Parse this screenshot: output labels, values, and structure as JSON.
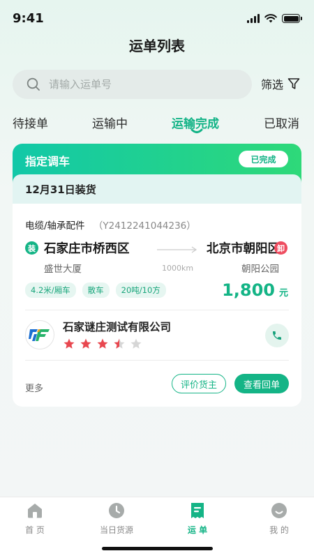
{
  "status_bar": {
    "time": "9:41"
  },
  "page": {
    "title": "运单列表"
  },
  "search": {
    "placeholder": "请输入运单号",
    "value": ""
  },
  "filter": {
    "label": "筛选",
    "icon": "filter-icon"
  },
  "tabs": [
    {
      "label": "待接单",
      "active": false
    },
    {
      "label": "运输中",
      "active": false
    },
    {
      "label": "运输完成",
      "active": true
    },
    {
      "label": "已取消",
      "active": false
    }
  ],
  "order": {
    "dispatch_type": "指定调车",
    "status": "已完成",
    "load_date": "12月31日装货",
    "cargo_name": "电缆/轴承配件",
    "order_id": "（Y2412241044236）",
    "origin": {
      "tag": "装",
      "city": "石家庄市桥西区",
      "place": "盛世大厦"
    },
    "destination": {
      "tag": "卸",
      "city": "北京市朝阳区",
      "place": "朝阳公园"
    },
    "distance": "1000km",
    "chips": [
      "4.2米/厢车",
      "散车",
      "20吨/10方"
    ],
    "price": "1,800",
    "price_unit": "元",
    "shipper": {
      "name": "石家谜庄测试有限公司",
      "rating": 3.5,
      "rating_max": 5
    },
    "more_label": "更多",
    "rate_button": "评价货主",
    "receipt_button": "查看回单"
  },
  "nav": [
    {
      "label": "首 页",
      "icon": "home-icon",
      "active": false
    },
    {
      "label": "当日货源",
      "icon": "clock-icon",
      "active": false
    },
    {
      "label": "运 单",
      "icon": "waybill-icon",
      "active": true
    },
    {
      "label": "我 的",
      "icon": "profile-icon",
      "active": false
    }
  ],
  "colors": {
    "accent": "#14b486",
    "unload_red": "#ee4c5f",
    "star_red": "#e8474f",
    "star_grey": "#d6d6d6"
  }
}
